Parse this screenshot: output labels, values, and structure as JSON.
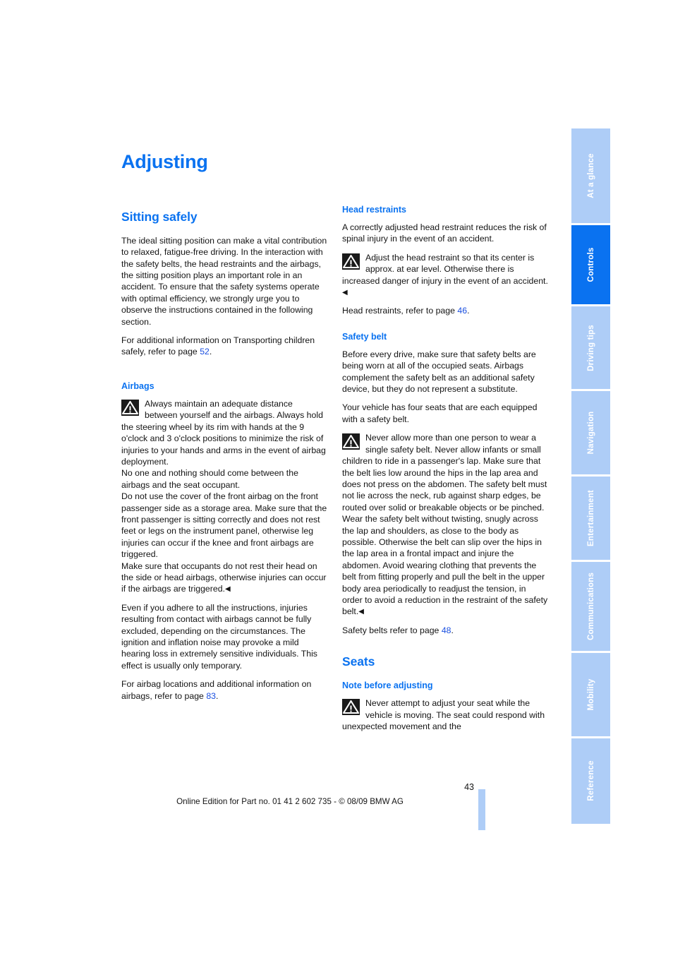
{
  "document": {
    "chapter_title": "Adjusting",
    "page_number": "43",
    "footer": "Online Edition for Part no. 01 41 2 602 735 - © 08/09 BMW AG"
  },
  "colors": {
    "heading_blue": "#0a72f0",
    "tab_inactive": "#aecdf7",
    "tab_active": "#0a72f0",
    "link_blue": "#1a4fe0",
    "body_text": "#141414"
  },
  "sidebar": {
    "tabs": [
      {
        "label": "At a glance",
        "active": false
      },
      {
        "label": "Controls",
        "active": true
      },
      {
        "label": "Driving tips",
        "active": false
      },
      {
        "label": "Navigation",
        "active": false
      },
      {
        "label": "Entertainment",
        "active": false
      },
      {
        "label": "Communications",
        "active": false
      },
      {
        "label": "Mobility",
        "active": false
      },
      {
        "label": "Reference",
        "active": false
      }
    ]
  },
  "left_column": {
    "section_title": "Sitting safely",
    "intro_paragraph": "The ideal sitting position can make a vital contribution to relaxed, fatigue-free driving. In the interaction with the safety belts, the head restraints and the airbags, the sitting position plays an important role in an accident. To ensure that the safety systems operate with optimal efficiency, we strongly urge you to observe the instructions contained in the following section.",
    "children_ref_prefix": "For additional information on Transporting children safely, refer to page ",
    "children_ref_page": "52",
    "children_ref_suffix": ".",
    "airbags_heading": "Airbags",
    "airbags_warning": "Always maintain an adequate distance between yourself and the airbags. Always hold the steering wheel by its rim with hands at the 9 o'clock and 3 o'clock positions to minimize the risk of injuries to your hands and arms in the event of airbag deployment.",
    "airbags_warning_2": "No one and nothing should come between the airbags and the seat occupant.",
    "airbags_warning_3": "Do not use the cover of the front airbag on the front passenger side as a storage area. Make sure that the front passenger is sitting correctly and does not rest feet or legs on the instrument panel, otherwise leg injuries can occur if the knee and front airbags are triggered.",
    "airbags_warning_4": "Make sure that occupants do not rest their head on the side or head airbags, otherwise injuries can occur if the airbags are triggered.",
    "airbags_note": "Even if you adhere to all the instructions, injuries resulting from contact with airbags cannot be fully excluded, depending on the circumstances. The ignition and inflation noise may provoke a mild hearing loss in extremely sensitive individuals. This effect is usually only temporary.",
    "airbags_ref_prefix": "For airbag locations and additional information on airbags, refer to page ",
    "airbags_ref_page": "83",
    "airbags_ref_suffix": "."
  },
  "right_column": {
    "head_restraints_heading": "Head restraints",
    "head_restraints_intro": "A correctly adjusted head restraint reduces the risk of spinal injury in the event of an accident.",
    "head_restraints_warning": "Adjust the head restraint so that its center is approx. at ear level. Otherwise there is increased danger of injury in the event of an accident.",
    "head_restraints_ref_prefix": "Head restraints, refer to page ",
    "head_restraints_ref_page": "46",
    "head_restraints_ref_suffix": ".",
    "safety_belt_heading": "Safety belt",
    "safety_belt_intro": "Before every drive, make sure that safety belts are being worn at all of the occupied seats. Airbags complement the safety belt as an additional safety device, but they do not represent a substitute.",
    "safety_belt_seats": "Your vehicle has four seats that are each equipped with a safety belt.",
    "safety_belt_warning": "Never allow more than one person to wear a single safety belt. Never allow infants or small children to ride in a passenger's lap. Make sure that the belt lies low around the hips in the lap area and does not press on the abdomen. The safety belt must not lie across the neck, rub against sharp edges, be routed over solid or breakable objects or be pinched. Wear the safety belt without twisting, snugly across the lap and shoulders, as close to the body as possible. Otherwise the belt can slip over the hips in the lap area in a frontal impact and injure the abdomen. Avoid wearing clothing that prevents the belt from fitting properly and pull the belt in the upper body area periodically to readjust the tension, in order to avoid a reduction in the restraint of the safety belt.",
    "safety_belt_ref_prefix": "Safety belts refer to page ",
    "safety_belt_ref_page": "48",
    "safety_belt_ref_suffix": ".",
    "seats_heading": "Seats",
    "note_before_adjusting_heading": "Note before adjusting",
    "note_before_adjusting_warning": "Never attempt to adjust your seat while the vehicle is moving. The seat could respond with unexpected movement and the"
  },
  "icons": {
    "warning_triangle": "warning-triangle-icon",
    "end_marker": "◀"
  }
}
